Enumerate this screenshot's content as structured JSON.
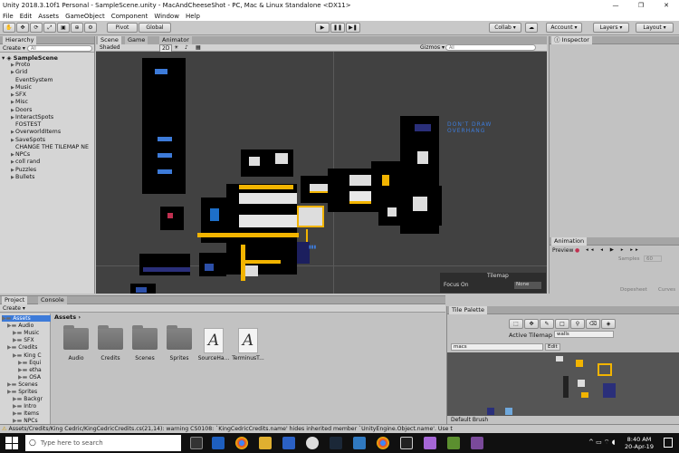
{
  "window": {
    "title": "Unity 2018.3.10f1 Personal - SampleScene.unity - MacAndCheeseShot - PC, Mac & Linux Standalone <DX11>",
    "minimize": "—",
    "maximize": "❐",
    "close": "✕"
  },
  "menu": [
    "File",
    "Edit",
    "Assets",
    "GameObject",
    "Component",
    "Window",
    "Help"
  ],
  "toolbar": {
    "pivot": "Pivot",
    "global": "Global",
    "collab": "Collab ▾",
    "account": "Account ▾",
    "layers": "Layers ▾",
    "layout": "Layout ▾",
    "play": "▶",
    "pause": "❚❚",
    "step": "▶❚"
  },
  "hierarchy": {
    "tab": "Hierarchy",
    "create": "Create ▾",
    "search_placeholder": "All",
    "scene": "SampleScene",
    "items": [
      "Proto",
      "Grid",
      "EventSystem",
      "Music",
      "SFX",
      "Misc",
      "Doors",
      "InteractSpots",
      "FOSTEST",
      "OverworldItems",
      "SaveSpots",
      "CHANGE THE TILEMAP NE",
      "NPCs",
      "coll rand",
      "Puzzles",
      "Bullets"
    ],
    "expandable": [
      true,
      true,
      false,
      true,
      true,
      true,
      true,
      true,
      false,
      true,
      true,
      false,
      true,
      true,
      true,
      true
    ]
  },
  "scene": {
    "tabs": [
      "Scene",
      "Game",
      "Animator"
    ],
    "shading": "Shaded",
    "mode2d": "2D",
    "gizmos": "Gizmos ▾",
    "search_placeholder": "All",
    "sign_text": [
      "DON'T DRAW",
      "OVERHANG"
    ],
    "overlay": {
      "title": "Tilemap",
      "focus_label": "Focus On",
      "focus_value": "None"
    }
  },
  "inspector": {
    "tab": "Inspector"
  },
  "animation": {
    "tab": "Animation",
    "preview": "Preview",
    "samples_label": "Samples",
    "samples_value": "60",
    "dopesheet": "Dopesheet",
    "curves": "Curves"
  },
  "project": {
    "tabs": [
      "Project",
      "Console"
    ],
    "create": "Create ▾",
    "root": "Assets",
    "tree": [
      {
        "label": "Assets",
        "level": 0
      },
      {
        "label": "Audio",
        "level": 1
      },
      {
        "label": "Music",
        "level": 2
      },
      {
        "label": "SFX",
        "level": 2
      },
      {
        "label": "Credits",
        "level": 1
      },
      {
        "label": "King C",
        "level": 2
      },
      {
        "label": "Equi",
        "level": 3
      },
      {
        "label": "etha",
        "level": 3
      },
      {
        "label": "OSA",
        "level": 3
      },
      {
        "label": "Scenes",
        "level": 1
      },
      {
        "label": "Sprites",
        "level": 1
      },
      {
        "label": "Backgr",
        "level": 2
      },
      {
        "label": "Intro",
        "level": 2
      },
      {
        "label": "Items",
        "level": 2
      },
      {
        "label": "NPCs",
        "level": 2
      }
    ],
    "breadcrumb": "Assets ›",
    "assets": [
      {
        "name": "Audio",
        "kind": "folder"
      },
      {
        "name": "Credits",
        "kind": "folder"
      },
      {
        "name": "Scenes",
        "kind": "folder"
      },
      {
        "name": "Sprites",
        "kind": "folder"
      },
      {
        "name": "SourceHa...",
        "kind": "font"
      },
      {
        "name": "TerminusT...",
        "kind": "font"
      }
    ]
  },
  "tile_palette": {
    "tab": "Tile Palette",
    "active_label": "Active Tilemap",
    "active_value": "walls",
    "palette_value": "macs",
    "edit": "Edit",
    "brush": "Default Brush"
  },
  "status": {
    "text": "Assets/Credits/King Cedric/KingCedricCredits.cs(21,14): warning CS0108: `KingCedricCredits.name' hides inherited member `UnityEngine.Object.name'. Use t"
  },
  "taskbar": {
    "search_placeholder": "Type here to search",
    "time": "8:40 AM",
    "date": "20-Apr-19"
  },
  "colors": {
    "accent": "#3d7bd9",
    "yellow": "#f2b400",
    "scene_bg": "#414141"
  }
}
